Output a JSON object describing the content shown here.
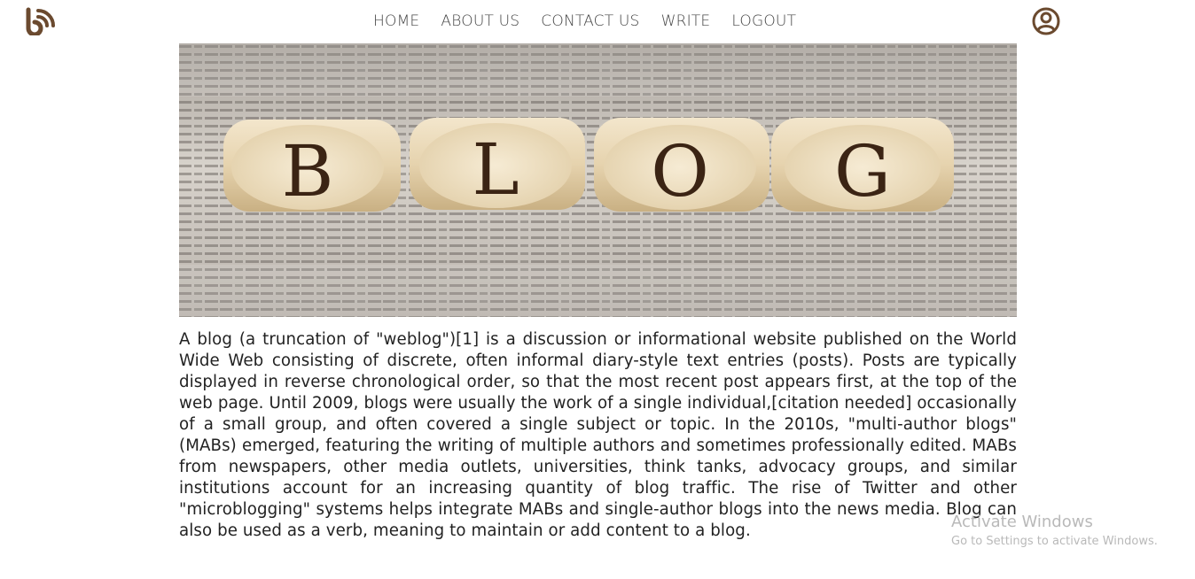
{
  "header": {
    "logo_icon": "blog-rss-logo-icon",
    "nav": [
      {
        "label": "HOME"
      },
      {
        "label": "ABOUT US"
      },
      {
        "label": "CONTACT US"
      },
      {
        "label": "WRITE"
      },
      {
        "label": "LOGOUT"
      }
    ],
    "profile_icon": "user-circle-icon",
    "accent_color": "#6b4a2f"
  },
  "hero": {
    "image": "wooden-blocks-spelling-blog-on-newspaper",
    "letters": [
      "B",
      "L",
      "O",
      "G"
    ]
  },
  "article": {
    "body": "A blog (a truncation of \"weblog\")[1] is a discussion or informational website published on the World Wide Web consisting of discrete, often informal diary-style text entries (posts). Posts are typically displayed in reverse chronological order, so that the most recent post appears first, at the top of the web page. Until 2009, blogs were usually the work of a single individual,[citation needed] occasionally of a small group, and often covered a single subject or topic. In the 2010s, \"multi-author blogs\" (MABs) emerged, featuring the writing of multiple authors and sometimes professionally edited. MABs from newspapers, other media outlets, universities, think tanks, advocacy groups, and similar institutions account for an increasing quantity of blog traffic. The rise of Twitter and other \"microblogging\" systems helps integrate MABs and single-author blogs into the news media. Blog can also be used as a verb, meaning to maintain or add content to a blog."
  },
  "watermark": {
    "title": "Activate Windows",
    "subtitle": "Go to Settings to activate Windows."
  }
}
